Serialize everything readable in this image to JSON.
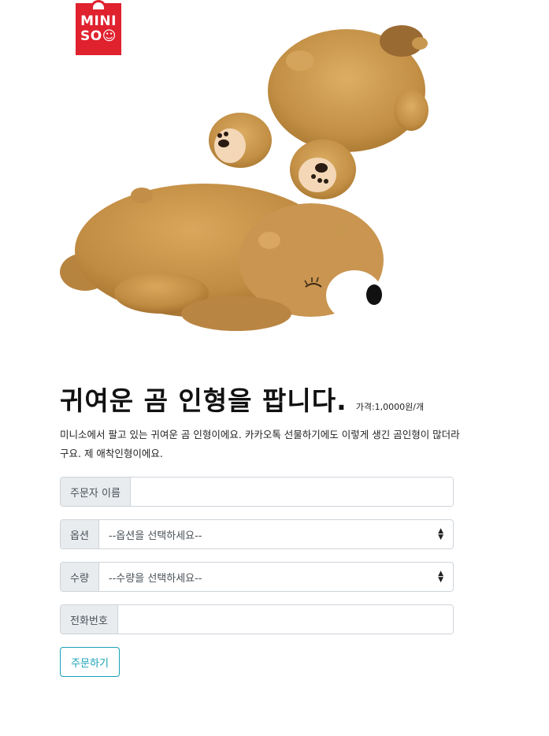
{
  "brand": {
    "logo_line1": "MINI",
    "logo_line2": "SO☺"
  },
  "product": {
    "title": "귀여운 곰 인형을 팝니다.",
    "price": "가격:1,0000원/개",
    "description": "미니소에서 팔고 있는 귀여운 곰 인형이에요. 카카오톡 선물하기에도 이렇게 생긴 곰인형이 많더라구요. 제 애착인형이에요."
  },
  "form": {
    "name_label": "주문자 이름",
    "name_value": "",
    "option_label": "옵션",
    "option_selected": "--옵션을 선택하세요--",
    "quantity_label": "수량",
    "quantity_selected": "--수량을 선택하세요--",
    "phone_label": "전화번호",
    "phone_value": "",
    "submit_label": "주문하기"
  },
  "colors": {
    "brand_red": "#e0212e",
    "accent_teal": "#17a2b8",
    "plush_tan": "#c8974f"
  }
}
